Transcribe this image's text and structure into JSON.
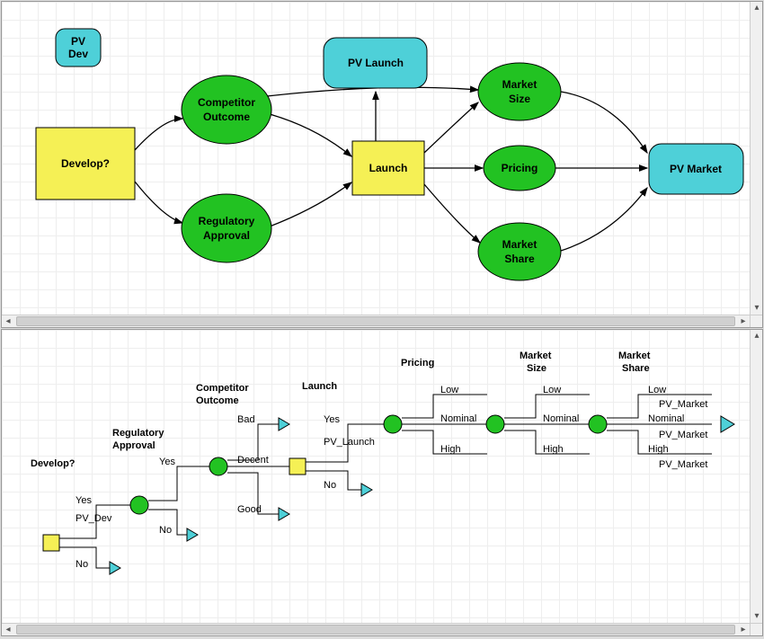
{
  "influence": {
    "nodes": {
      "pv_dev": {
        "label": "PV Dev"
      },
      "develop": {
        "label": "Develop?"
      },
      "comp_out": {
        "label1": "Competitor",
        "label2": "Outcome"
      },
      "reg_app": {
        "label1": "Regulatory",
        "label2": "Approval"
      },
      "pv_launch": {
        "label": "PV Launch"
      },
      "launch": {
        "label": "Launch"
      },
      "mkt_size": {
        "label1": "Market",
        "label2": "Size"
      },
      "pricing": {
        "label": "Pricing"
      },
      "mkt_share": {
        "label1": "Market",
        "label2": "Share"
      },
      "pv_market": {
        "label": "PV Market"
      }
    }
  },
  "tree": {
    "headers": {
      "develop": "Develop?",
      "reg_app": "Regulatory Approval",
      "comp_out": "Competitor Outcome",
      "launch": "Launch",
      "pricing": "Pricing",
      "mkt_size": "Market Size",
      "mkt_share": "Market Share"
    },
    "branches": {
      "develop": {
        "yes": "Yes",
        "no": "No",
        "pv": "PV_Dev"
      },
      "reg_app": {
        "yes": "Yes",
        "no": "No"
      },
      "comp_out": {
        "bad": "Bad",
        "decent": "Decent",
        "good": "Good"
      },
      "launch": {
        "yes": "Yes",
        "no": "No",
        "pv": "PV_Launch"
      },
      "pricing": {
        "low": "Low",
        "nom": "Nominal",
        "high": "High"
      },
      "mkt_size": {
        "low": "Low",
        "nom": "Nominal",
        "high": "High"
      },
      "mkt_share": {
        "low": "Low",
        "nom": "Nominal",
        "high": "High",
        "pv": "PV_Market"
      }
    }
  },
  "colors": {
    "yellow": "#f5f055",
    "green": "#22c222",
    "cyan": "#4ed0d8",
    "stroke": "#000"
  }
}
